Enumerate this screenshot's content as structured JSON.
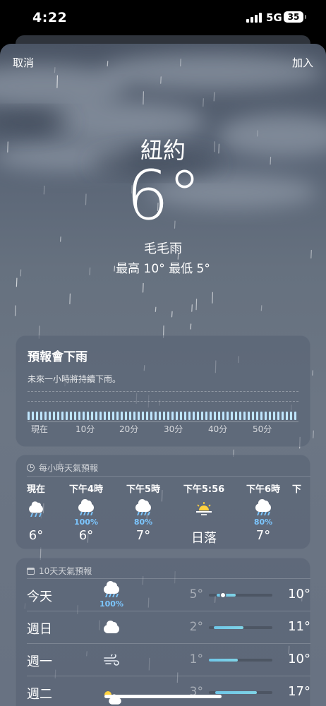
{
  "status_bar": {
    "time": "4:22",
    "network": "5G",
    "battery": "35"
  },
  "nav": {
    "cancel_label": "取消",
    "add_label": "加入"
  },
  "current": {
    "city": "紐約",
    "temperature": "6°",
    "condition": "毛毛雨",
    "high_low": "最高 10°  最低 5°"
  },
  "precip_card": {
    "title": "預報會下雨",
    "subtitle": "未來一小時將持續下雨。",
    "ticks": [
      "現在",
      "10分",
      "20分",
      "30分",
      "40分",
      "50分"
    ]
  },
  "hourly": {
    "header": "每小時天氣預報",
    "items": [
      {
        "time": "現在",
        "icon": "cloud-rain-icon",
        "precip": "",
        "temp": "6°"
      },
      {
        "time": "下午4時",
        "icon": "cloud-heavy-rain-icon",
        "precip": "100%",
        "temp": "6°"
      },
      {
        "time": "下午5時",
        "icon": "cloud-heavy-rain-icon",
        "precip": "80%",
        "temp": "7°"
      },
      {
        "time": "下午5:56",
        "icon": "sunset-icon",
        "precip": "",
        "temp": "日落"
      },
      {
        "time": "下午6時",
        "icon": "cloud-heavy-rain-icon",
        "precip": "80%",
        "temp": "7°"
      },
      {
        "time": "下",
        "icon": "",
        "precip": "",
        "temp": ""
      }
    ]
  },
  "daily": {
    "header": "10天天氣預報",
    "items": [
      {
        "day": "今天",
        "icon": "cloud-heavy-rain-icon",
        "precip": "100%",
        "low": "5°",
        "high": "10°",
        "bar_start": 0.12,
        "bar_end": 0.42,
        "current_marker": 0.22
      },
      {
        "day": "週日",
        "icon": "cloud-icon",
        "precip": "",
        "low": "2°",
        "high": "11°",
        "bar_start": 0.08,
        "bar_end": 0.55
      },
      {
        "day": "週一",
        "icon": "wind-icon",
        "precip": "",
        "low": "1°",
        "high": "10°",
        "bar_start": 0.0,
        "bar_end": 0.46
      },
      {
        "day": "週二",
        "icon": "sun-cloud-icon",
        "precip": "",
        "low": "3°",
        "high": "17°",
        "bar_start": 0.1,
        "bar_end": 0.75
      }
    ]
  },
  "colors": {
    "precip": "#7cc6ff",
    "temp_bar": "#6ec6e8",
    "rain_bar": "#bfe6ff"
  }
}
